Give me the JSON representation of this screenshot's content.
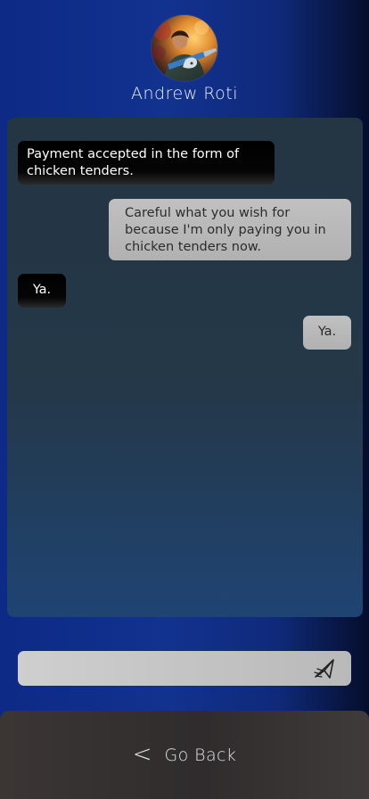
{
  "contact": {
    "name": "Andrew Roti"
  },
  "messages": [
    {
      "direction": "received",
      "text": "Payment accepted in the form of chicken tenders."
    },
    {
      "direction": "sent",
      "text": "Careful what you wish for because I'm only paying you in chicken tenders now."
    },
    {
      "direction": "received",
      "text": "Ya."
    },
    {
      "direction": "sent",
      "text": "Ya."
    }
  ],
  "composer": {
    "value": "",
    "send_icon": "paper-plane-icon"
  },
  "footer": {
    "back_icon": "chevron-left-icon",
    "back_label": "Go Back"
  },
  "colors": {
    "background": "#12328f",
    "received_bubble": "#000000",
    "sent_bubble": "#b9b9b9",
    "panel": "#243849"
  }
}
